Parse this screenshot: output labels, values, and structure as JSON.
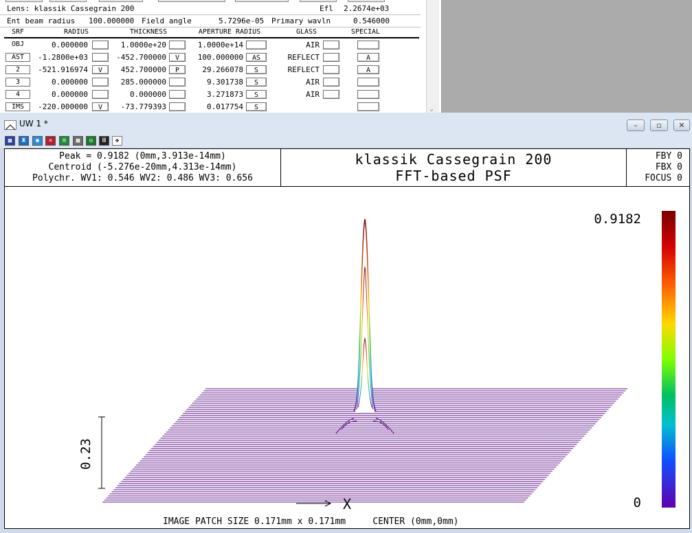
{
  "lens_window": {
    "lens_label": "Lens: klassik Cassegrain 200",
    "efl_label": "Efl",
    "efl_value": "2.2674e+03",
    "ent_beam_label": "Ent beam radius",
    "ent_beam_value": "100.000000",
    "field_angle_label": "Field angle",
    "field_angle_value": "5.7296e-05",
    "primary_wavln_label": "Primary wavln",
    "primary_wavln_value": "0.546000",
    "headers": [
      "SRF",
      "RADIUS",
      "THICKNESS",
      "APERTURE RADIUS",
      "GLASS",
      "SPECIAL"
    ],
    "rows": [
      {
        "srf": "OBJ",
        "radius": "0.000000",
        "rsolve": "",
        "thickness": "1.0000e+20",
        "tsolve": "",
        "aperture": "1.0000e+14",
        "asolve": "",
        "glass": "AIR",
        "special": ""
      },
      {
        "srf": "AST",
        "radius": "-1.2800e+03",
        "rsolve": "",
        "thickness": "-452.700000",
        "tsolve": "V",
        "aperture": "100.000000",
        "asolve": "AS",
        "glass": "REFLECT",
        "special": "A"
      },
      {
        "srf": "2",
        "radius": "-521.916974",
        "rsolve": "V",
        "thickness": "452.700000",
        "tsolve": "P",
        "aperture": "29.266078",
        "asolve": "S",
        "glass": "REFLECT",
        "special": "A"
      },
      {
        "srf": "3",
        "radius": "0.000000",
        "rsolve": "",
        "thickness": "285.000000",
        "tsolve": "",
        "aperture": "9.301738",
        "asolve": "S",
        "glass": "AIR",
        "special": ""
      },
      {
        "srf": "4",
        "radius": "0.000000",
        "rsolve": "",
        "thickness": "0.000000",
        "tsolve": "",
        "aperture": "3.271873",
        "asolve": "S",
        "glass": "AIR",
        "special": ""
      },
      {
        "srf": "IMS",
        "radius": "-220.000000",
        "rsolve": "V",
        "thickness": "-73.779393",
        "tsolve": "",
        "aperture": "0.017754",
        "asolve": "S",
        "glass": "",
        "special": ""
      }
    ]
  },
  "uw_window": {
    "title": "UW 1 *",
    "minimize_glyph": "–",
    "restore_glyph": "▫",
    "close_glyph": "✕",
    "info_left": {
      "peak": "Peak = 0.9182 (0mm,3.913e-14mm)",
      "centroid": "Centroid (-5.276e-20mm,4.313e-14mm)",
      "polychr": "Polychr. WV1: 0.546 WV2: 0.486 WV3: 0.656"
    },
    "plot_title": "klassik Cassegrain 200",
    "plot_subtitle": "FFT-based PSF",
    "info_right": {
      "fby": "FBY 0",
      "fbx": "FBX 0",
      "focus": "FOCUS 0"
    },
    "colorbar_max": "0.9182",
    "colorbar_min": "0",
    "scale_bar_label": "0.23",
    "x_axis_label": "X",
    "bottom_label": "IMAGE PATCH SIZE 0.171mm x 0.171mm     CENTER (0mm,0mm)",
    "colors": {
      "base_lines": "#5b0f87",
      "peak_top": "#7d0b0b",
      "accent": "#dce6f2"
    }
  },
  "chart_data": {
    "type": "surface",
    "title": "klassik Cassegrain 200",
    "subtitle": "FFT-based PSF",
    "peak_value": 0.9182,
    "zlim": [
      0,
      0.9182
    ],
    "scale_bar_value": 0.23,
    "x_axis_label": "X"
  }
}
